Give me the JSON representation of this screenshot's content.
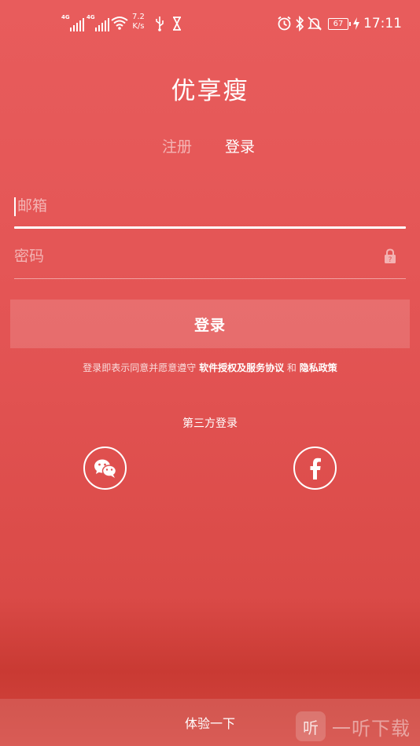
{
  "status_bar": {
    "sim1_label": "4G",
    "sim2_label": "4G",
    "net_speed_value": "7.2",
    "net_speed_unit": "K/s",
    "battery": "67",
    "time": "17:11"
  },
  "app": {
    "title": "优享瘦"
  },
  "tabs": {
    "register": "注册",
    "login": "登录"
  },
  "form": {
    "email_placeholder": "邮箱",
    "password_placeholder": "密码",
    "login_button": "登录"
  },
  "agreement": {
    "prefix": "登录即表示同意并愿意遵守 ",
    "software_license": "软件授权及服务协议",
    "conjunction": " 和 ",
    "privacy_policy": "隐私政策"
  },
  "third_party": {
    "title": "第三方登录"
  },
  "footer": {
    "trial_label": "体验一下"
  },
  "watermark": {
    "logo_char": "听",
    "text": "一听下载"
  },
  "colors": {
    "background_top": "#e85c5c",
    "background_bottom": "#c93a33",
    "text": "#ffffff"
  }
}
